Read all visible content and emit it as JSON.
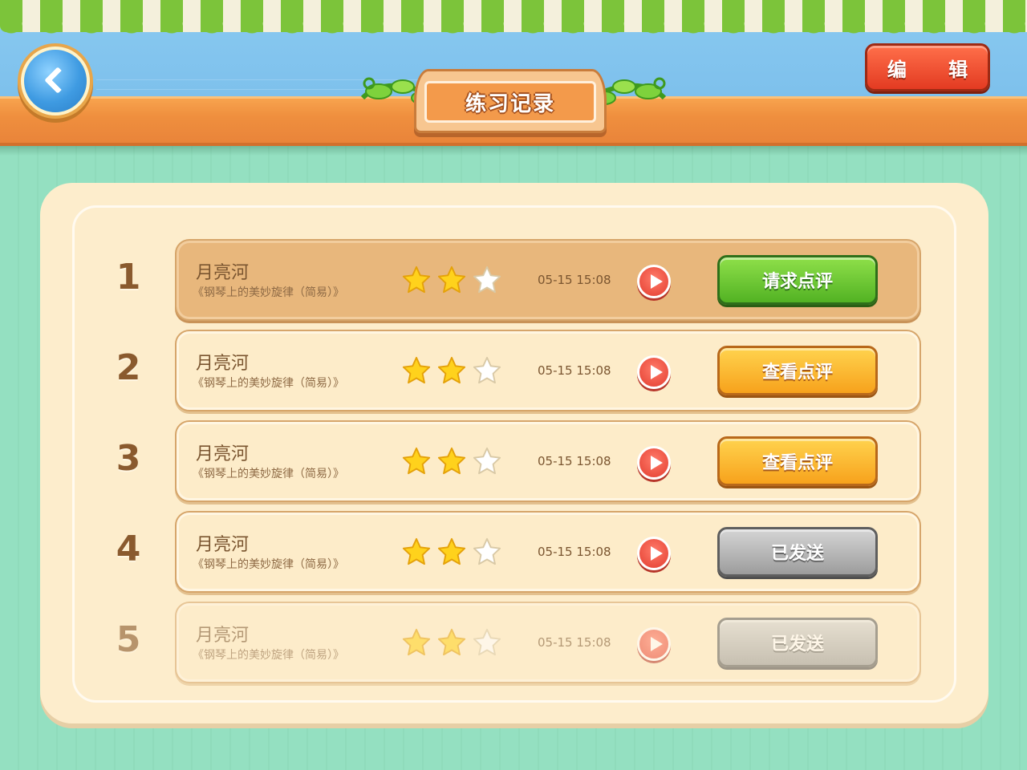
{
  "header": {
    "title": "练习记录",
    "edit_label": "编 辑"
  },
  "records": [
    {
      "rank": "1",
      "title": "月亮河",
      "subtitle": "《钢琴上的美妙旋律（简易）》",
      "stars": 2,
      "time": "05-15 15:08",
      "action": "请求点评",
      "action_style": "green"
    },
    {
      "rank": "2",
      "title": "月亮河",
      "subtitle": "《钢琴上的美妙旋律（简易）》",
      "stars": 2,
      "time": "05-15 15:08",
      "action": "查看点评",
      "action_style": "orange"
    },
    {
      "rank": "3",
      "title": "月亮河",
      "subtitle": "《钢琴上的美妙旋律（简易）》",
      "stars": 2,
      "time": "05-15 15:08",
      "action": "查看点评",
      "action_style": "orange"
    },
    {
      "rank": "4",
      "title": "月亮河",
      "subtitle": "《钢琴上的美妙旋律（简易）》",
      "stars": 2,
      "time": "05-15 15:08",
      "action": "已发送",
      "action_style": "gray"
    },
    {
      "rank": "5",
      "title": "月亮河",
      "subtitle": "《钢琴上的美妙旋律（简易）》",
      "stars": 2,
      "time": "05-15 15:08",
      "action": "已发送",
      "action_style": "gray"
    }
  ],
  "max_stars": 3,
  "colors": {
    "star_filled": "#ffd21c",
    "star_empty": "#ffffff"
  }
}
